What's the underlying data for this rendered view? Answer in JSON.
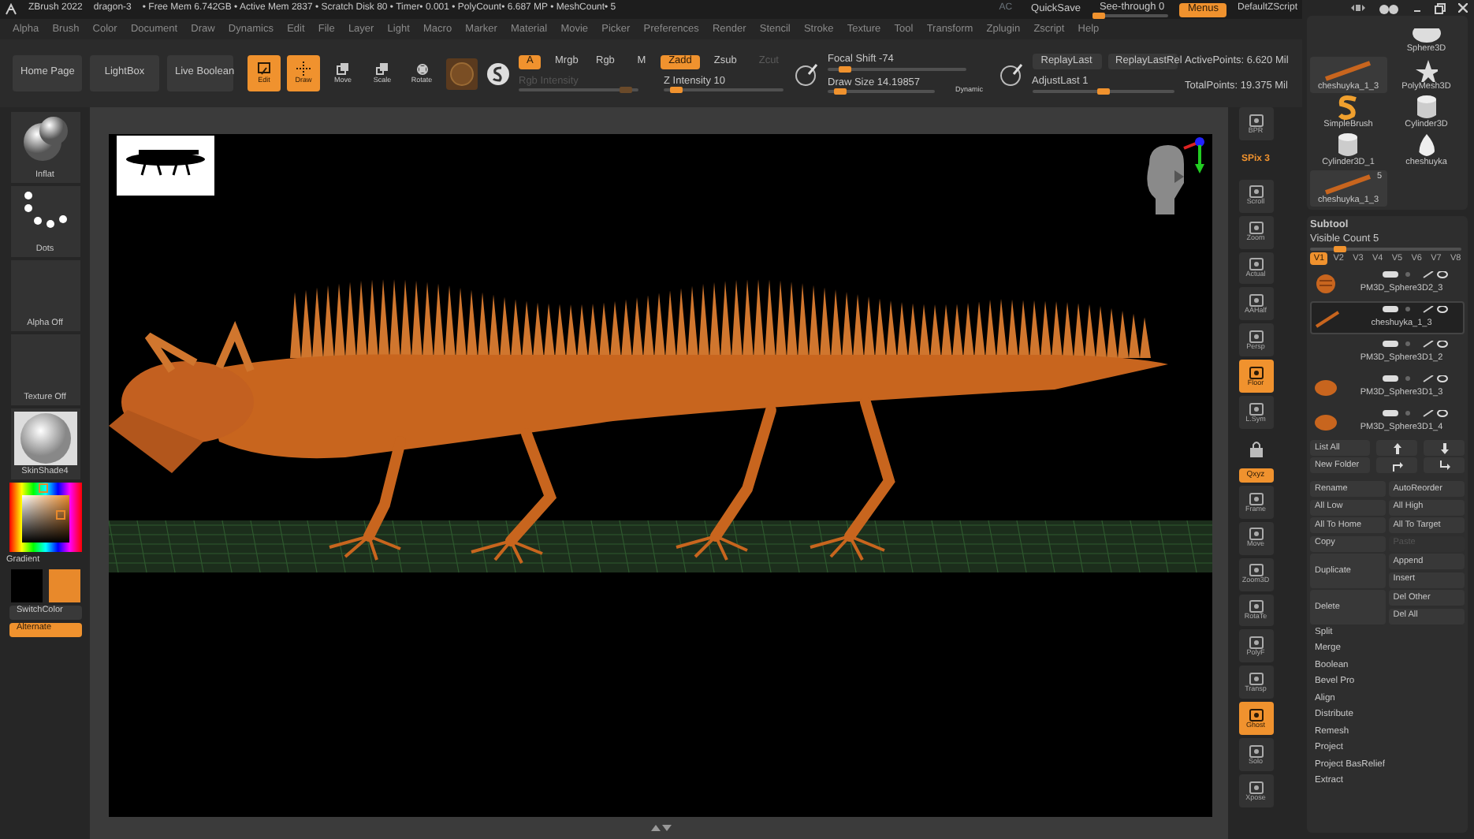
{
  "title_bar": {
    "app": "ZBrush 2022",
    "document": "dragon-3",
    "status": "• Free Mem 6.742GB • Active Mem 2837 • Scratch Disk 80 • Timer• 0.001 • PolyCount• 6.687 MP • MeshCount• 5",
    "ac": "AC",
    "quicksave": "QuickSave",
    "see_through": {
      "label": "See-through  0",
      "level": 0
    },
    "menus": {
      "label": "Menus",
      "selected": true
    },
    "script": "DefaultZScript"
  },
  "menu_bar": [
    "Alpha",
    "Brush",
    "Color",
    "Document",
    "Draw",
    "Dynamics",
    "Edit",
    "File",
    "Layer",
    "Light",
    "Macro",
    "Marker",
    "Material",
    "Movie",
    "Picker",
    "Preferences",
    "Render",
    "Stencil",
    "Stroke",
    "Texture",
    "Tool",
    "Transform",
    "Zplugin",
    "Zscript",
    "Help"
  ],
  "shelf": {
    "nav_buttons": [
      "Home Page",
      "LightBox",
      "Live Boolean"
    ],
    "modes": [
      {
        "label": "Edit",
        "selected": true
      },
      {
        "label": "Draw",
        "selected": true
      },
      {
        "label": "Move",
        "selected": false
      },
      {
        "label": "Scale",
        "selected": false
      },
      {
        "label": "Rotate",
        "selected": false
      }
    ],
    "channels": [
      {
        "label": "A",
        "selected": true
      },
      {
        "label": "Mrgb",
        "selected": false
      },
      {
        "label": "Rgb",
        "selected": false
      },
      {
        "label": "M",
        "selected": false
      }
    ],
    "depth": [
      {
        "label": "Zadd",
        "selected": true,
        "disabled": false
      },
      {
        "label": "Zsub",
        "selected": false,
        "disabled": false
      },
      {
        "label": "Zcut",
        "selected": false,
        "disabled": true
      }
    ],
    "intensity": [
      {
        "label": "Rgb Intensity",
        "level": 0.9,
        "disabled": true
      },
      {
        "label": "Z Intensity 10",
        "level": 0.1,
        "disabled": false
      }
    ],
    "focal_shift": {
      "label": "Focal Shift -74",
      "level": 0.13
    },
    "draw_size": {
      "label": "Draw Size 14.19857",
      "level": 0.12
    },
    "dynamic": "Dynamic",
    "replay": [
      "ReplayLast",
      "ReplayLastRel"
    ],
    "adjust_last": {
      "label": "AdjustLast 1",
      "level": 0.5
    },
    "active_points": "ActivePoints: 6.620 Mil",
    "total_points": "TotalPoints: 19.375 Mil"
  },
  "left_panel": {
    "tiles": [
      {
        "label": "Inflat",
        "kind": "sphere"
      },
      {
        "label": "Dots",
        "kind": "dots"
      },
      {
        "label": "Alpha Off",
        "kind": "empty"
      },
      {
        "label": "Texture Off",
        "kind": "empty"
      },
      {
        "label": "SkinShade4",
        "kind": "material"
      }
    ],
    "gradient": "Gradient",
    "swatches": [
      {
        "color": "#000000"
      },
      {
        "color": "#e8892b"
      }
    ],
    "switch_color": "SwitchColor",
    "alternate": {
      "label": "Alternate",
      "selected": true
    }
  },
  "right_toolbar": [
    {
      "label": "BPR",
      "kind": "button",
      "selected": false
    },
    {
      "label": "SPix 3",
      "kind": "text"
    },
    {
      "label": "Scroll",
      "kind": "button",
      "selected": false
    },
    {
      "label": "Zoom",
      "kind": "button",
      "selected": false
    },
    {
      "label": "Actual",
      "kind": "button",
      "selected": false
    },
    {
      "label": "AAHalf",
      "kind": "button",
      "selected": false
    },
    {
      "label": "Persp",
      "kind": "button",
      "selected": false
    },
    {
      "label": "Floor",
      "kind": "button",
      "selected": true
    },
    {
      "label": "L.Sym",
      "kind": "button",
      "selected": false
    },
    {
      "kind": "lock"
    },
    {
      "label": "Qxyz",
      "kind": "toggle",
      "selected": true
    },
    {
      "label": "Frame",
      "kind": "button",
      "selected": false
    },
    {
      "label": "Move",
      "kind": "button",
      "selected": false
    },
    {
      "label": "Zoom3D",
      "kind": "button",
      "selected": false
    },
    {
      "label": "RotaTe",
      "kind": "button",
      "selected": false
    },
    {
      "label": "PolyF",
      "kind": "button",
      "selected": false
    },
    {
      "label": "Transp",
      "kind": "button",
      "selected": false
    },
    {
      "label": "Ghost",
      "kind": "button",
      "selected": true
    },
    {
      "label": "Solo",
      "kind": "button",
      "selected": false
    },
    {
      "label": "Xpose",
      "kind": "button",
      "selected": false
    }
  ],
  "right_panel": {
    "tools": [
      {
        "label": "Sphere3D",
        "kind": "sphere",
        "selected": false
      },
      {
        "label": "cheshuyka_1_3",
        "kind": "stick",
        "selected": true
      },
      {
        "label": "PolyMesh3D",
        "kind": "star",
        "selected": false
      },
      {
        "label": "SimpleBrush",
        "kind": "brush",
        "selected": false
      },
      {
        "label": "Cylinder3D",
        "kind": "cylinder",
        "selected": false
      },
      {
        "label": "Cylinder3D_1",
        "kind": "cylinder",
        "selected": false
      },
      {
        "label": "cheshuyka",
        "kind": "egg",
        "selected": false
      },
      {
        "label": "cheshuyka_1_3",
        "kind": "stick",
        "selected": true,
        "count": "5"
      }
    ],
    "subtool": {
      "title": "Subtool",
      "visible_count": {
        "label": "Visible Count 5",
        "level": 0.2
      },
      "versions": [
        {
          "label": "V1",
          "selected": true
        },
        {
          "label": "V2",
          "selected": false
        },
        {
          "label": "V3",
          "selected": false
        },
        {
          "label": "V4",
          "selected": false
        },
        {
          "label": "V5",
          "selected": false
        },
        {
          "label": "V6",
          "selected": false
        },
        {
          "label": "V7",
          "selected": false
        },
        {
          "label": "V8",
          "selected": false
        }
      ],
      "items": [
        {
          "name": "PM3D_Sphere3D2_3",
          "kind": "head",
          "selected": false
        },
        {
          "name": "cheshuyka_1_3",
          "kind": "stick",
          "selected": true
        },
        {
          "name": "PM3D_Sphere3D1_2",
          "kind": "none",
          "selected": false
        },
        {
          "name": "PM3D_Sphere3D1_3",
          "kind": "ball",
          "selected": false
        },
        {
          "name": "PM3D_Sphere3D1_4",
          "kind": "ball",
          "selected": false
        }
      ],
      "list_all": "List All",
      "new_folder": "New Folder",
      "buttons": [
        {
          "label": "Rename",
          "kind": "normal",
          "disabled": false
        },
        {
          "label": "AutoReorder",
          "kind": "normal",
          "disabled": false
        },
        {
          "label": "All Low",
          "kind": "normal",
          "disabled": false
        },
        {
          "label": "All High",
          "kind": "normal",
          "disabled": false
        },
        {
          "label": "All To Home",
          "kind": "normal",
          "disabled": false
        },
        {
          "label": "All To Target",
          "kind": "normal",
          "disabled": false
        },
        {
          "label": "Copy",
          "kind": "normal",
          "disabled": false
        },
        {
          "label": "Paste",
          "kind": "normal",
          "disabled": true
        },
        {
          "label": "Append",
          "kind": "side",
          "disabled": false
        },
        {
          "label": "Duplicate",
          "kind": "tall",
          "disabled": false
        },
        {
          "label": "Insert",
          "kind": "side",
          "disabled": false
        },
        {
          "label": "Del Other",
          "kind": "side",
          "disabled": false
        },
        {
          "label": "Delete",
          "kind": "tall",
          "disabled": false
        },
        {
          "label": "Del All",
          "kind": "side",
          "disabled": false
        }
      ],
      "actions": [
        "Split",
        "Merge",
        "Boolean",
        "Bevel Pro",
        "Align",
        "Distribute",
        "Remesh",
        "Project",
        "Project BasRelief",
        "Extract"
      ]
    }
  }
}
